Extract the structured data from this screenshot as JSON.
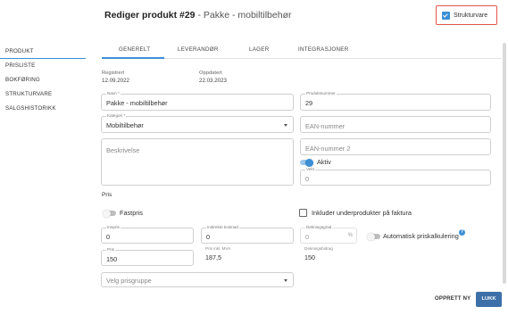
{
  "header": {
    "title_bold": "Rediger produkt #29",
    "title_sub": " - Pakke - mobiltilbehør",
    "strukturvare_label": "Strukturvare"
  },
  "sidebar": {
    "items": [
      {
        "label": "PRODUKT"
      },
      {
        "label": "PRISLISTE"
      },
      {
        "label": "BOKFØRING"
      },
      {
        "label": "STRUKTURVARE"
      },
      {
        "label": "SALGSHISTORIKK"
      }
    ]
  },
  "tabs": [
    {
      "label": "GENERELT"
    },
    {
      "label": "LEVERANDØR"
    },
    {
      "label": "LAGER"
    },
    {
      "label": "INTEGRASJONER"
    }
  ],
  "meta": {
    "registrert_label": "Registrert",
    "registrert_value": "12.09.2022",
    "oppdatert_label": "Oppdatert",
    "oppdatert_value": "22.03.2023"
  },
  "fields": {
    "navn": {
      "label": "Navn *",
      "value": "Pakke - mobiltilbehør"
    },
    "produktnummer": {
      "label": "Produktnummer",
      "value": "29"
    },
    "kategori": {
      "label": "Kategori *",
      "value": "Mobiltilbehør"
    },
    "ean": {
      "placeholder": "EAN-nummer"
    },
    "ean2": {
      "placeholder": "EAN-nummer 2"
    },
    "beskrivelse": {
      "placeholder": "Beskrivelse"
    },
    "vekt": {
      "label": "Vekt",
      "value": "0"
    }
  },
  "aktiv_label": "Aktiv",
  "pris": {
    "section_title": "Pris",
    "fastpris_label": "Fastpris",
    "inkluder_label": "Inkluder underprodukter på faktura",
    "innpris": {
      "label": "Innpris",
      "value": "0"
    },
    "indirekte": {
      "label": "Indirekte kostnad",
      "value": "0"
    },
    "dekningsgrad": {
      "label": "Dekningsgrad",
      "value": "0",
      "unit": "%"
    },
    "auto_label": "Automatisk priskalkulering",
    "help_glyph": "?",
    "pris": {
      "label": "Pris",
      "value": "150"
    },
    "pris_mva": {
      "label": "Pris inkl. MVA",
      "value": "187,5"
    },
    "dekningsbidrag": {
      "label": "Dekningsbidrag",
      "value": "150"
    },
    "prisgruppe_placeholder": "Velg prisgruppe"
  },
  "footer": {
    "opprett_ny": "OPPRETT NY",
    "lukk": "LUKK"
  },
  "colors": {
    "accent": "#3d8fd6",
    "highlight_border": "#e2564a",
    "primary_button": "#3d6fa8"
  }
}
